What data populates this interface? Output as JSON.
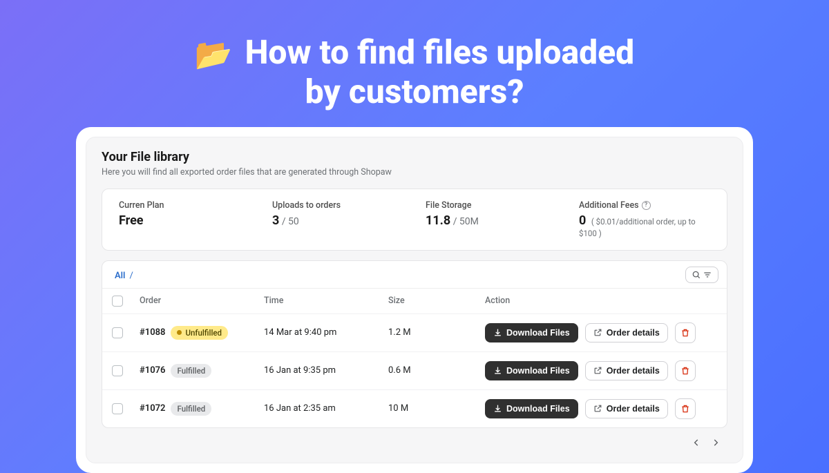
{
  "hero": {
    "emoji": "📂",
    "title_line1": "How to find files uploaded",
    "title_line2": "by customers?"
  },
  "library": {
    "title": "Your File library",
    "subtitle": "Here you will find all exported order files that are generated through Shopaw"
  },
  "stats": {
    "plan": {
      "label": "Curren Plan",
      "value": "Free"
    },
    "uploads": {
      "label": "Uploads to orders",
      "value": "3",
      "max": "/ 50"
    },
    "storage": {
      "label": "File Storage",
      "value": "11.8",
      "max": "/ 50M"
    },
    "fees": {
      "label": "Additional Fees",
      "value": "0",
      "note": "( $0.01/additional order, up to $100 )"
    }
  },
  "tabs": {
    "all": "All",
    "sep": "/"
  },
  "columns": {
    "order": "Order",
    "time": "Time",
    "size": "Size",
    "action": "Action"
  },
  "actions": {
    "download": "Download Files",
    "details": "Order details"
  },
  "statuses": {
    "unfulfilled": "Unfulfilled",
    "fulfilled": "Fulfilled"
  },
  "rows": [
    {
      "order": "#1088",
      "status": "unfulfilled",
      "time": "14 Mar at 9:40 pm",
      "size": "1.2 M"
    },
    {
      "order": "#1076",
      "status": "fulfilled",
      "time": "16 Jan at 9:35 pm",
      "size": "0.6 M"
    },
    {
      "order": "#1072",
      "status": "fulfilled",
      "time": "16 Jan at 2:35 am",
      "size": "10 M"
    }
  ]
}
